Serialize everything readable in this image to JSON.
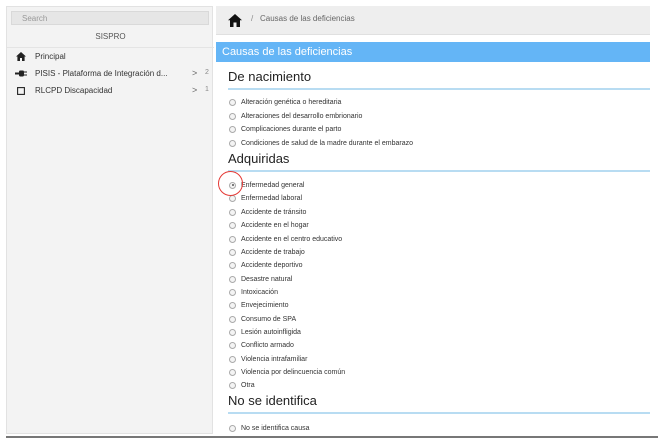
{
  "sidebar": {
    "search_placeholder": "Search",
    "app_name": "SISPRO",
    "items": [
      {
        "label": "Principal",
        "icon": "home-icon"
      },
      {
        "label": "PISIS - Plataforma de Integración d...",
        "icon": "plug-icon",
        "chevron": ">",
        "count": "2"
      },
      {
        "label": "RLCPD Discapacidad",
        "icon": "square-icon",
        "chevron": ">",
        "count": "1"
      }
    ]
  },
  "topbar": {
    "separator": "/",
    "breadcrumb": "Causas de las deficiencias"
  },
  "panel": {
    "title": "Causas de las deficiencias"
  },
  "sections": {
    "nacimiento": {
      "title": "De nacimiento",
      "options": [
        "Alteración genética o hereditaria",
        "Alteraciones del desarrollo embrionario",
        "Complicaciones durante el parto",
        "Condiciones de salud de la madre durante el embarazo"
      ]
    },
    "adquiridas": {
      "title": "Adquiridas",
      "selected": "Enfermedad general",
      "options": [
        "Enfermedad general",
        "Enfermedad laboral",
        "Accidente de tránsito",
        "Accidente en el hogar",
        "Accidente en el centro educativo",
        "Accidente de trabajo",
        "Accidente deportivo",
        "Desastre natural",
        "Intoxicación",
        "Envejecimiento",
        "Consumo de SPA",
        "Lesión autoinfligida",
        "Conflicto armado",
        "Violencia intrafamiliar",
        "Violencia por delincuencia común",
        "Otra"
      ]
    },
    "no_identifica": {
      "title": "No se identifica",
      "options": [
        "No se identifica causa"
      ]
    }
  },
  "colors": {
    "panel_header": "#64b5f6",
    "section_rule": "#b8dcf2",
    "highlight_circle": "#e53935"
  }
}
